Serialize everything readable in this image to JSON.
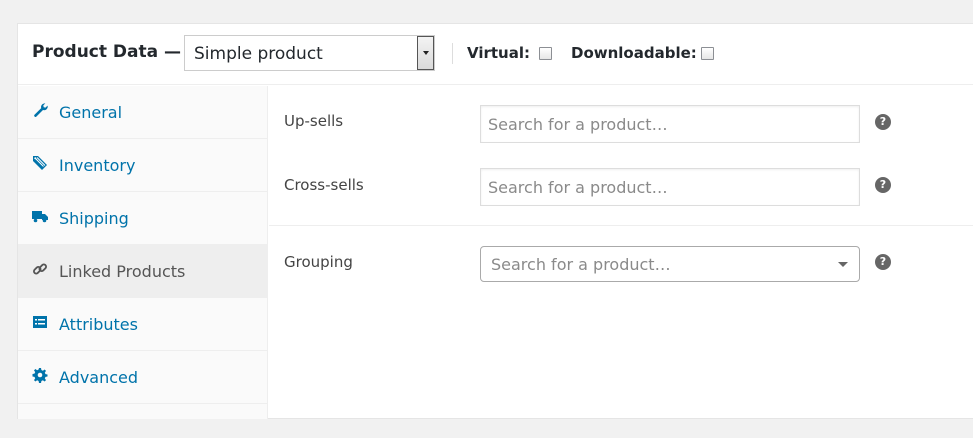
{
  "header": {
    "title": "Product Data —",
    "product_type": {
      "selected": "Simple product",
      "icon": "dropdown-arrow-icon"
    },
    "virtual_label": "Virtual:",
    "virtual_checked": false,
    "downloadable_label": "Downloadable:",
    "downloadable_checked": false
  },
  "tabs": [
    {
      "label": "General",
      "icon": "wrench-icon",
      "active": false
    },
    {
      "label": "Inventory",
      "icon": "tag-icon",
      "active": false
    },
    {
      "label": "Shipping",
      "icon": "truck-icon",
      "active": false
    },
    {
      "label": "Linked Products",
      "icon": "link-icon",
      "active": true
    },
    {
      "label": "Attributes",
      "icon": "list-icon",
      "active": false
    },
    {
      "label": "Advanced",
      "icon": "gear-icon",
      "active": false
    }
  ],
  "fields": {
    "upsells": {
      "label": "Up-sells",
      "placeholder": "Search for a product…",
      "help": "?"
    },
    "crosssells": {
      "label": "Cross-sells",
      "placeholder": "Search for a product…",
      "help": "?"
    },
    "grouping": {
      "label": "Grouping",
      "placeholder": "Search for a product…",
      "help": "?"
    }
  },
  "colors": {
    "link": "#0073aa",
    "active_tab_bg": "#eeeeee",
    "tab_bg": "#fafafa",
    "page_bg": "#f1f1f1"
  }
}
